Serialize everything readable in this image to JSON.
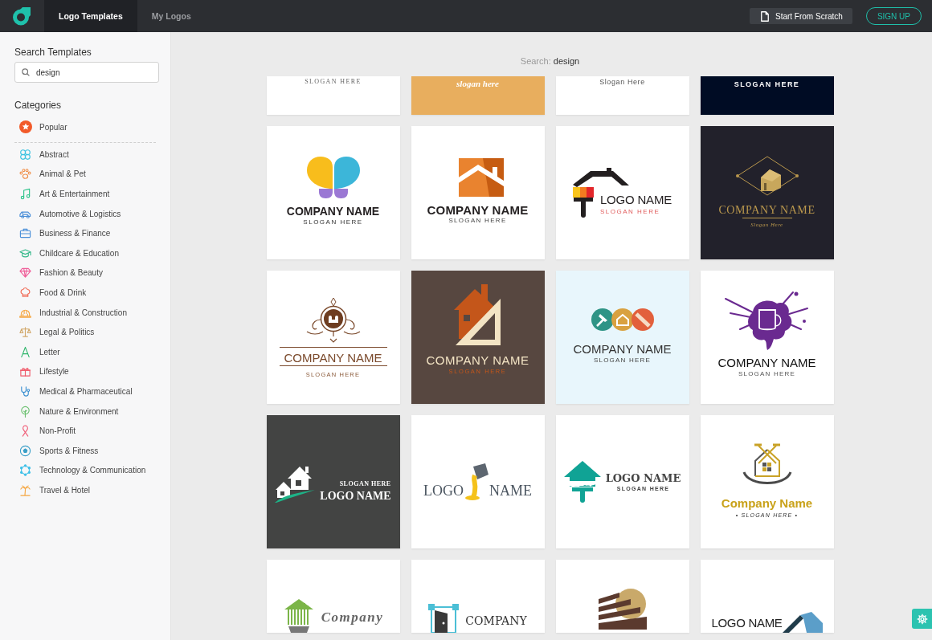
{
  "topbar": {
    "tabs": [
      {
        "label": "Logo Templates",
        "selected": true
      },
      {
        "label": "My Logos",
        "selected": false
      }
    ],
    "scratch_button": "Start From Scratch",
    "signup_button": "SIGN UP"
  },
  "sidebar": {
    "search_title": "Search Templates",
    "search": {
      "value": "design"
    },
    "categories_title": "Categories",
    "featured": "Popular",
    "categories": [
      "Abstract",
      "Animal & Pet",
      "Art & Entertainment",
      "Automotive & Logistics",
      "Business & Finance",
      "Childcare & Education",
      "Fashion & Beauty",
      "Food & Drink",
      "Industrial & Construction",
      "Legal & Politics",
      "Letter",
      "Lifestyle",
      "Medical & Pharmaceutical",
      "Nature & Environment",
      "Non-Profit",
      "Sports & Fitness",
      "Technology & Communication",
      "Travel & Hotel"
    ]
  },
  "results": {
    "search_label": "Search:",
    "search_query": "design",
    "templates": [
      {
        "kind": "serif",
        "slogan": "SLOGAN HERE"
      },
      {
        "kind": "script",
        "slogan": "slogan here"
      },
      {
        "kind": "plain",
        "slogan": "Slogan Here"
      },
      {
        "kind": "navy",
        "slogan": "SLOGAN HERE"
      },
      {
        "kind": "butterfly",
        "name": "COMPANY NAME",
        "slogan": "SLOGAN HERE"
      },
      {
        "kind": "squarehouse",
        "name": "COMPANY NAME",
        "slogan": "SLOGAN HERE"
      },
      {
        "kind": "brushhouse",
        "name": "LOGO NAME",
        "slogan": "SLOGAN HERE"
      },
      {
        "kind": "diamond",
        "name": "COMPANY NAME",
        "slogan": "Slogan Here"
      },
      {
        "kind": "ornament",
        "name": "COMPANY NAME",
        "slogan": "SLOGAN HERE"
      },
      {
        "kind": "ruler",
        "name": "COMPANY NAME",
        "slogan": "SLOGAN HERE"
      },
      {
        "kind": "tools",
        "name": "COMPANY NAME",
        "slogan": "SLOGAN HERE"
      },
      {
        "kind": "splash",
        "name": "COMPANY NAME",
        "slogan": "SLOGAN HERE"
      },
      {
        "kind": "swoosh",
        "slogan": "SLOGAN HERE",
        "name": "LOGO NAME"
      },
      {
        "kind": "pour",
        "name": "LOGO",
        "name_end": "NAME"
      },
      {
        "kind": "tealhouse",
        "name": "LOGO NAME",
        "slogan": "SLOGAN HERE"
      },
      {
        "kind": "hammers",
        "name": "Company Name",
        "slogan": "• SLOGAN HERE •"
      },
      {
        "kind": "bamboo",
        "name": "Company"
      },
      {
        "kind": "door",
        "name": "COMPANY"
      },
      {
        "kind": "stairs"
      },
      {
        "kind": "roof",
        "name": "LOGO NAME"
      }
    ]
  }
}
